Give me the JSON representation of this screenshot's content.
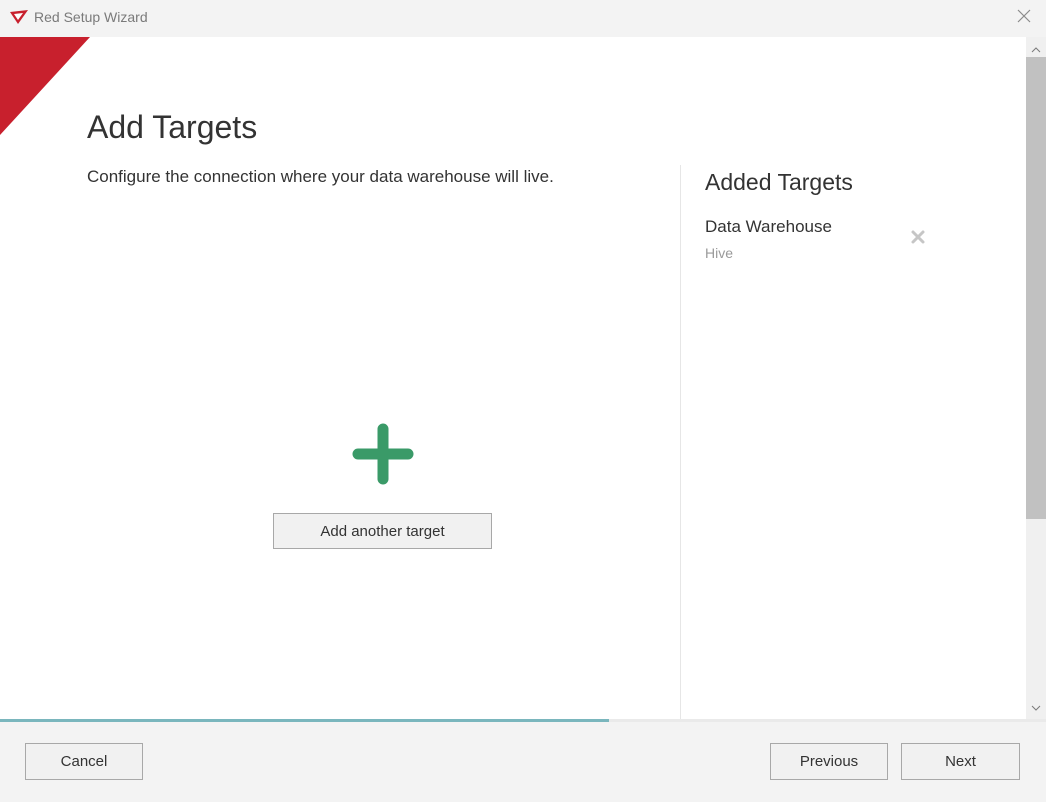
{
  "window": {
    "title": "Red Setup Wizard",
    "logo_icon": "red-logo-icon",
    "close_icon": "close-icon"
  },
  "page": {
    "title": "Add Targets",
    "subtitle": "Configure the connection where your data warehouse will live."
  },
  "added_targets": {
    "heading": "Added Targets",
    "items": [
      {
        "name": "Data Warehouse",
        "type": "Hive",
        "remove_icon": "remove-x-icon"
      }
    ]
  },
  "add_target": {
    "icon": "plus-icon",
    "button_label": "Add another target"
  },
  "progress": {
    "fraction": 0.582
  },
  "footer": {
    "cancel_label": "Cancel",
    "previous_label": "Previous",
    "next_label": "Next"
  },
  "colors": {
    "brand_red": "#c8202d",
    "plus_green": "#3a9a68",
    "progress": "#7ab6bd"
  }
}
